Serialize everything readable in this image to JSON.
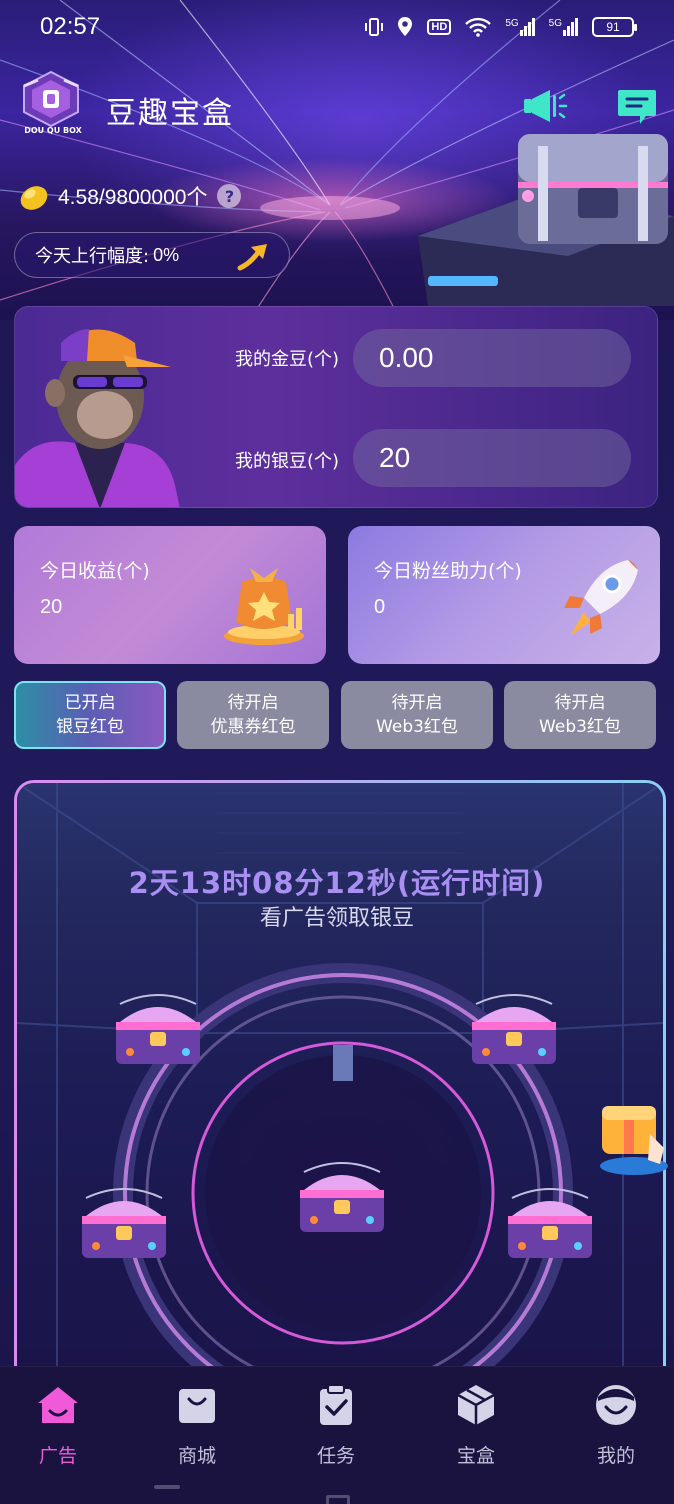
{
  "status_bar": {
    "time": "02:57",
    "icons": [
      "vibrate-icon",
      "location-icon",
      "hd-icon",
      "wifi-icon",
      "signal-5g-icon",
      "signal-5g-icon"
    ],
    "hd_label": "HD",
    "net1": "5G",
    "net2": "5G",
    "battery": "91"
  },
  "header": {
    "logo_text": "DOU QU BOX",
    "title": "豆趣宝盒",
    "bean_value": "4.58/9800000个",
    "help": "?",
    "trend_label": "今天上行幅度:",
    "trend_value": "0%"
  },
  "balance": {
    "gold_label": "我的金豆(个)",
    "gold_value": "0.00",
    "silver_label": "我的银豆(个)",
    "silver_value": "20"
  },
  "stats": [
    {
      "title": "今日收益(个)",
      "value": "20"
    },
    {
      "title": "今日粉丝助力(个)",
      "value": "0"
    }
  ],
  "packet_tabs": [
    {
      "line1": "已开启",
      "line2": "银豆红包",
      "active": true
    },
    {
      "line1": "待开启",
      "line2": "优惠券红包",
      "active": false
    },
    {
      "line1": "待开启",
      "line2": "Web3红包",
      "active": false
    },
    {
      "line1": "待开启",
      "line2": "Web3红包",
      "active": false
    }
  ],
  "ad": {
    "runtime": "2天13时08分12秒(运行时间)",
    "subtitle": "看广告领取银豆"
  },
  "colors": {
    "accent_pink": "#f05ad8",
    "runtime_purple": "#a98ff2",
    "active_tab_border": "#7de3f0"
  },
  "bottom_nav": [
    {
      "label": "广告",
      "icon": "home-icon",
      "active": true
    },
    {
      "label": "商城",
      "icon": "shopping-bag-icon",
      "active": false
    },
    {
      "label": "任务",
      "icon": "clipboard-check-icon",
      "active": false
    },
    {
      "label": "宝盒",
      "icon": "box-icon",
      "active": false
    },
    {
      "label": "我的",
      "icon": "profile-icon",
      "active": false
    }
  ]
}
